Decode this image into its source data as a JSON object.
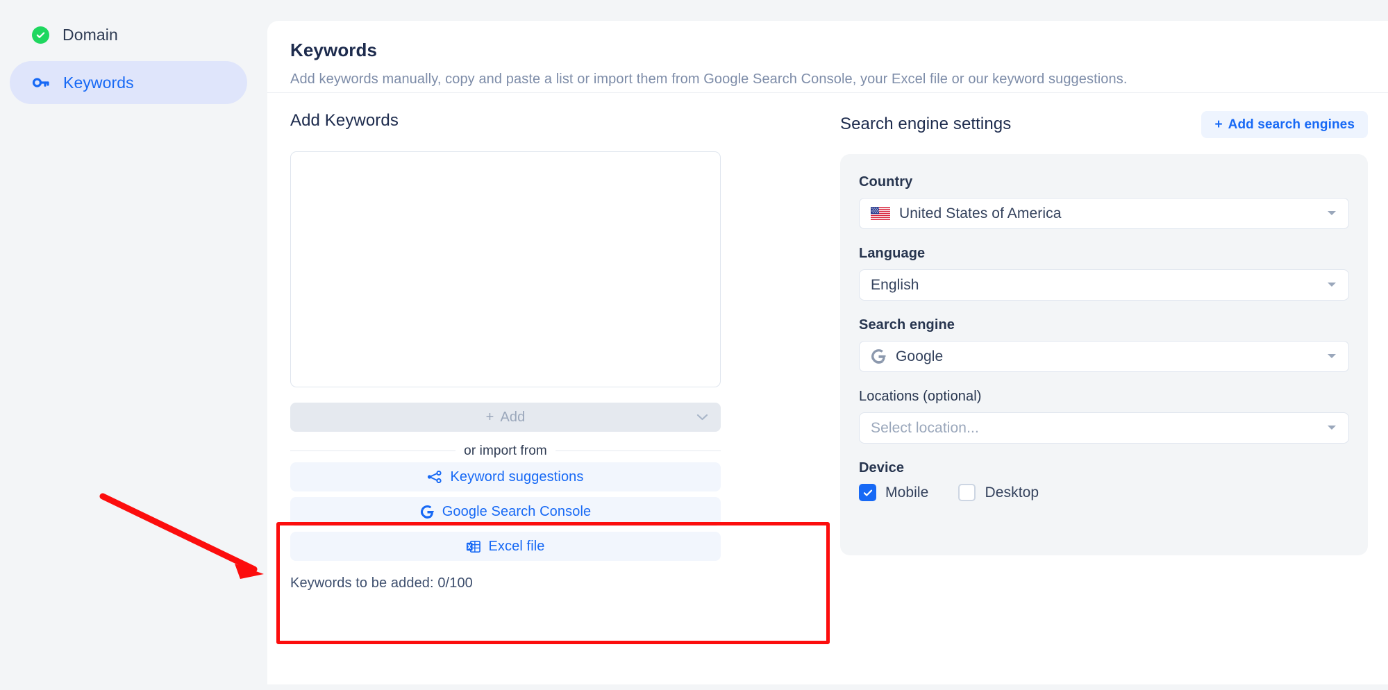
{
  "sidebar": {
    "items": [
      {
        "label": "Domain",
        "icon": "check-circle-icon",
        "state": "completed"
      },
      {
        "label": "Keywords",
        "icon": "key-icon",
        "state": "active"
      }
    ]
  },
  "header": {
    "title": "Keywords",
    "subtitle": "Add keywords manually, copy and paste a list or import them from Google Search Console, your Excel file or our keyword suggestions."
  },
  "add_keywords": {
    "section_title": "Add Keywords",
    "textarea_value": "",
    "textarea_placeholder": "",
    "add_button_label": "Add",
    "add_button_icon": "plus-icon",
    "add_button_caret": "chevron-down-icon",
    "divider_label": "or import from",
    "import_buttons": [
      {
        "label": "Keyword suggestions",
        "icon": "keyword-suggestions-icon"
      },
      {
        "label": "Google Search Console",
        "icon": "google-icon"
      },
      {
        "label": "Excel file",
        "icon": "excel-icon"
      }
    ],
    "counter": "Keywords to be added: 0/100"
  },
  "search_engine_settings": {
    "title": "Search engine settings",
    "add_button_label": "Add search engines",
    "add_button_icon": "plus-icon",
    "fields": [
      {
        "label": "Country",
        "value": "United States of America",
        "icon": "us-flag-icon",
        "is_placeholder": false
      },
      {
        "label": "Language",
        "value": "English",
        "icon": "",
        "is_placeholder": false
      },
      {
        "label": "Search engine",
        "value": "Google",
        "icon": "google-icon",
        "is_placeholder": false
      },
      {
        "label": "Locations (optional)",
        "value": "Select location...",
        "icon": "",
        "is_placeholder": true
      }
    ],
    "device": {
      "label": "Device",
      "options": [
        {
          "label": "Mobile",
          "checked": true
        },
        {
          "label": "Desktop",
          "checked": false
        }
      ]
    }
  },
  "annotations": {
    "highlight_box_color": "#fc0d0d",
    "arrow_color": "#fc0d0d"
  },
  "colors": {
    "accent_blue": "#1769f5",
    "success_green": "#1ed75f",
    "text_dark": "#1d2b4d",
    "text_muted": "#7d8ca8",
    "page_bg": "#f3f5f7",
    "panel_bg": "#ffffff"
  }
}
